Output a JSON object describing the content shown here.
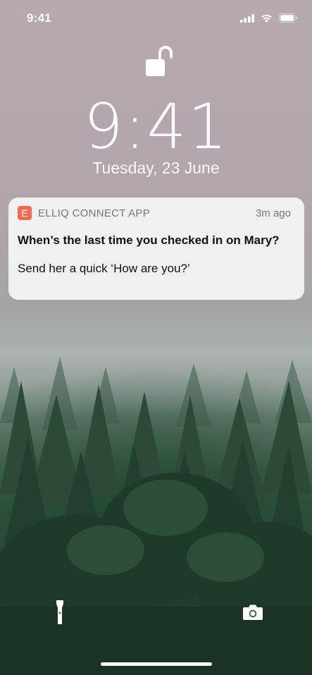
{
  "status_bar": {
    "time": "9:41",
    "icons": [
      "cellular-signal-icon",
      "wifi-icon",
      "battery-icon"
    ]
  },
  "lock_screen": {
    "lock_icon": "unlocked-padlock-icon",
    "time": "9:41",
    "date": "Tuesday,  23 June"
  },
  "notification": {
    "app_icon_letter": "E",
    "app_name": "ELLIQ CONNECT APP",
    "time_ago": "3m ago",
    "title": "When’s the last time you checked in on Mary?",
    "body": "Send her a quick ‘How are you?’"
  },
  "quick_actions": {
    "left": "flashlight-icon",
    "right": "camera-icon"
  },
  "colors": {
    "app_icon": "#f06a55",
    "notification_bg": "#f4f2f3",
    "sky": "#b8a9b1",
    "forest": "#1d3526"
  }
}
